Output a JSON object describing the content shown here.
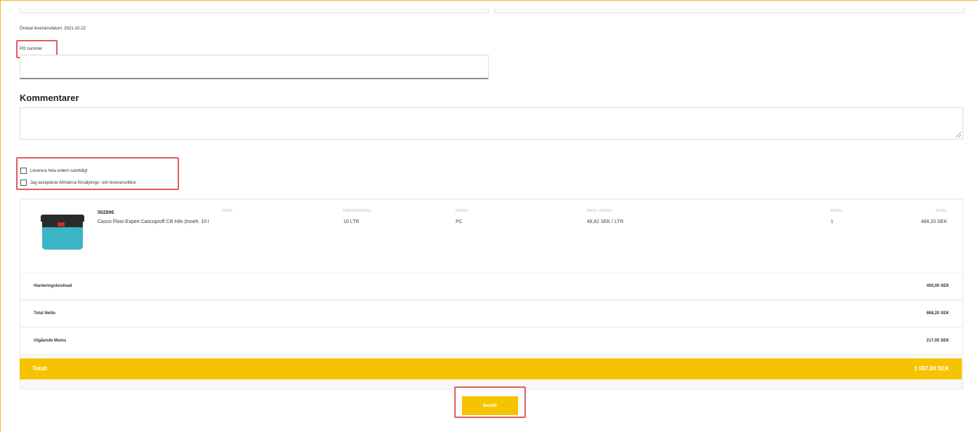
{
  "delivery": {
    "requested_date_text": "Önskat leveransdatum: 2021-10-22"
  },
  "po": {
    "label": "PO nummer",
    "value": "",
    "placeholder": ""
  },
  "comments": {
    "title": "Kommentarer",
    "value": ""
  },
  "options": {
    "deliver_together_label": "Leverera hela ordern samtidigt",
    "accept_terms_label": "Jag accepterar Allmänna försäljnings- och leveransvillkor"
  },
  "product": {
    "sku": "502896",
    "name": "Casco Floor Expert Cascoproff CR Hilo (Inneh. 10 l",
    "columns": {
      "color": "FÄRG",
      "package_size": "FÖRPACKNING",
      "unit": "ENHET",
      "price_unit": "PRIS / ENHET",
      "quantity": "ANTAL",
      "total": "TOTAL"
    },
    "values": {
      "package_size": "10 LTR",
      "unit": "PC",
      "price_unit": "48,82 SEK / LTR",
      "quantity": "1",
      "total": "488,20 SEK"
    },
    "image_icon": "paint-bucket-icon",
    "image_colors": {
      "body": "#3bb5c3",
      "lid": "#2b2b2b",
      "logo": "#d02a2a"
    }
  },
  "summary": {
    "handling_label": "Hanteringskostnad",
    "handling_value": "400,00 SEK",
    "net_label": "Total Netto",
    "net_value": "868,20 SEK",
    "vat_label": "Utgående Moms",
    "vat_value": "217,05 SEK",
    "total_label": "Totalt",
    "total_value": "1 087,00 SEK"
  },
  "actions": {
    "order_label": "Beställ"
  },
  "colors": {
    "accent": "#f5c300",
    "highlight": "#e05b63",
    "frame": "#f2b233"
  }
}
